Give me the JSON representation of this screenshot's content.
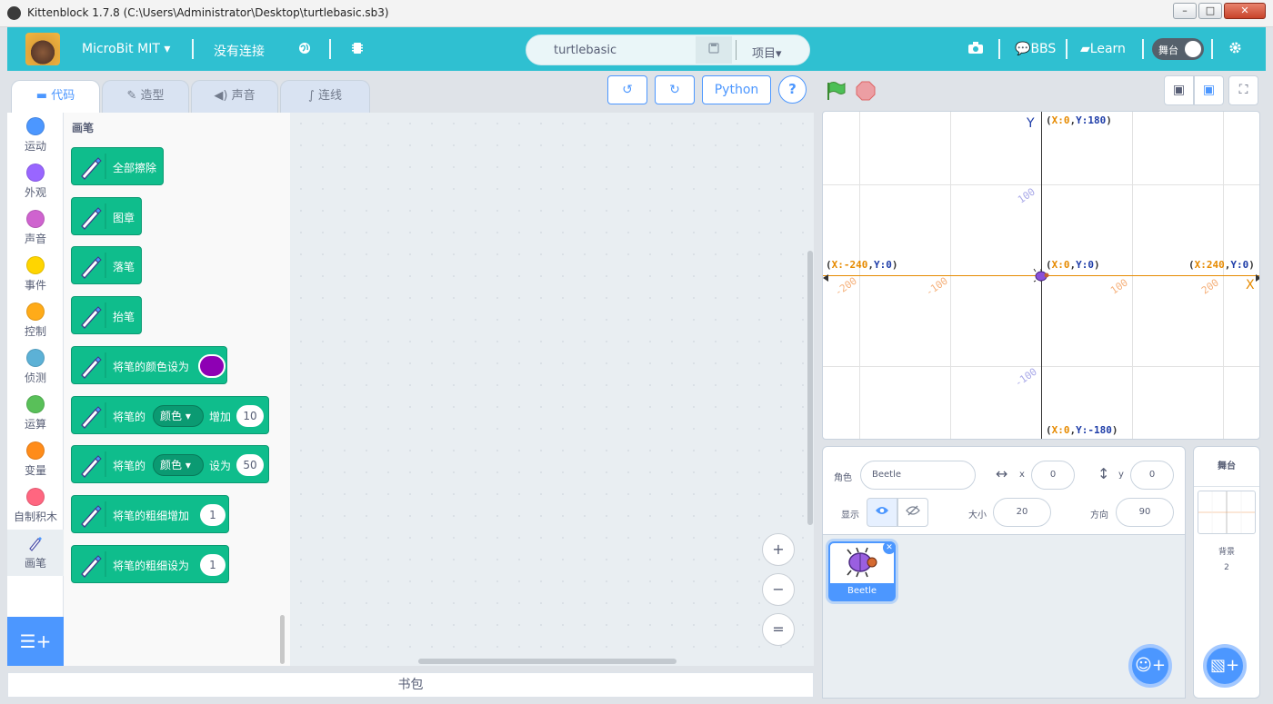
{
  "window": {
    "title": "Kittenblock 1.7.8 (C:\\Users\\Administrator\\Desktop\\turtlebasic.sb3)",
    "min": "–",
    "max": "□",
    "close": "✕"
  },
  "menubar": {
    "device": "MicroBit MIT",
    "connection": "没有连接",
    "project_name": "turtlebasic",
    "project_menu": "项目",
    "bbs": "BBS",
    "learn": "Learn",
    "stage_toggle": "舞台",
    "accent": "#2fc0d1"
  },
  "tabs": [
    {
      "label": "代码"
    },
    {
      "label": "造型"
    },
    {
      "label": "声音"
    },
    {
      "label": "连线"
    }
  ],
  "toolbar": {
    "python": "Python",
    "help": "?"
  },
  "categories": [
    {
      "label": "运动",
      "color": "#4c97ff"
    },
    {
      "label": "外观",
      "color": "#9966ff"
    },
    {
      "label": "声音",
      "color": "#cf63cf"
    },
    {
      "label": "事件",
      "color": "#ffd500"
    },
    {
      "label": "控制",
      "color": "#ffab19"
    },
    {
      "label": "侦测",
      "color": "#5cb1d6"
    },
    {
      "label": "运算",
      "color": "#59c059"
    },
    {
      "label": "变量",
      "color": "#ff8c1a"
    },
    {
      "label": "自制积木",
      "color": "#ff6680"
    },
    {
      "label": "画笔",
      "color": "#0fbd8c"
    }
  ],
  "palette": {
    "header": "画笔",
    "blocks": [
      {
        "text": "全部擦除"
      },
      {
        "text": "图章"
      },
      {
        "text": "落笔"
      },
      {
        "text": "抬笔"
      },
      {
        "text": "将笔的颜色设为",
        "color": "#8e00b4"
      },
      {
        "text": "将笔的",
        "dropdown": "颜色",
        "op": "增加",
        "value": "10"
      },
      {
        "text": "将笔的",
        "dropdown": "颜色",
        "op": "设为",
        "value": "50"
      },
      {
        "text": "将笔的粗细增加",
        "value": "1"
      },
      {
        "text": "将笔的粗细设为",
        "value": "1"
      }
    ]
  },
  "zoom": {
    "in": "+",
    "out": "−",
    "reset": "="
  },
  "backpack": "书包",
  "stage": {
    "y_axis": "Y",
    "x_axis": "X",
    "coords": {
      "top": {
        "x": "0",
        "y": "180"
      },
      "bottom": {
        "x": "0",
        "y": "-180"
      },
      "left": {
        "x": "-240",
        "y": "0"
      },
      "right": {
        "x": "240",
        "y": "0"
      },
      "center": {
        "x": "0",
        "y": "0"
      }
    },
    "x_ticks": [
      "-200",
      "-100",
      "100",
      "200"
    ],
    "y_ticks": [
      "100",
      "-100"
    ]
  },
  "sprite": {
    "label_sprite": "角色",
    "name": "Beetle",
    "label_x": "x",
    "x": "0",
    "label_y": "y",
    "y": "0",
    "label_show": "显示",
    "label_size": "大小",
    "size": "20",
    "label_direction": "方向",
    "direction": "90"
  },
  "sprites": [
    {
      "name": "Beetle"
    }
  ],
  "stage_panel": {
    "title": "舞台",
    "backdrops_label": "背景",
    "backdrops_count": "2"
  }
}
